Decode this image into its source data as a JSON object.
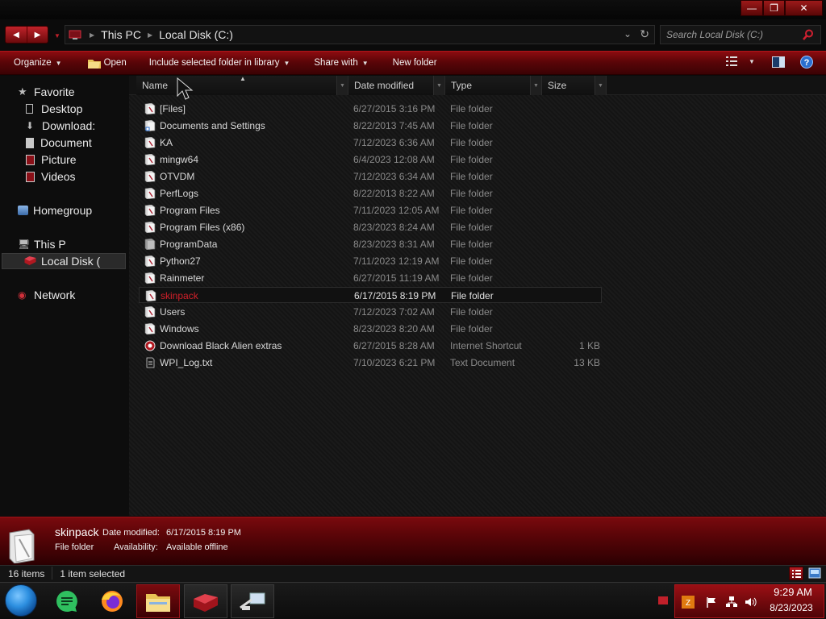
{
  "address": {
    "crumbs": [
      "This PC",
      "Local Disk (C:)"
    ]
  },
  "search": {
    "placeholder": "Search Local Disk (C:)"
  },
  "commandbar": {
    "organize": "Organize",
    "open": "Open",
    "include": "Include selected folder in library",
    "share": "Share with",
    "new_folder": "New folder"
  },
  "nav": {
    "favorites": "Favorite",
    "desktop": "Desktop",
    "downloads": "Download:",
    "documents": "Document",
    "pictures": "Picture",
    "videos": "Videos",
    "homegroup": "Homegroup",
    "thispc": "This P",
    "localdisk": "Local Disk (",
    "network": "Network"
  },
  "columns": {
    "name": "Name",
    "date": "Date modified",
    "type": "Type",
    "size": "Size"
  },
  "files": [
    {
      "name": "[Files]",
      "date": "6/27/2015 3:16 PM",
      "type": "File folder",
      "size": "",
      "icon": "folder-icon"
    },
    {
      "name": "Documents and Settings",
      "date": "8/22/2013 7:45 AM",
      "type": "File folder",
      "size": "",
      "icon": "folder-link-icon"
    },
    {
      "name": "KA",
      "date": "7/12/2023 6:36 AM",
      "type": "File folder",
      "size": "",
      "icon": "folder-icon"
    },
    {
      "name": "mingw64",
      "date": "6/4/2023 12:08 AM",
      "type": "File folder",
      "size": "",
      "icon": "folder-icon"
    },
    {
      "name": "OTVDM",
      "date": "7/12/2023 6:34 AM",
      "type": "File folder",
      "size": "",
      "icon": "folder-icon"
    },
    {
      "name": "PerfLogs",
      "date": "8/22/2013 8:22 AM",
      "type": "File folder",
      "size": "",
      "icon": "folder-icon"
    },
    {
      "name": "Program Files",
      "date": "7/11/2023 12:05 AM",
      "type": "File folder",
      "size": "",
      "icon": "folder-icon"
    },
    {
      "name": "Program Files (x86)",
      "date": "8/23/2023 8:24 AM",
      "type": "File folder",
      "size": "",
      "icon": "folder-icon"
    },
    {
      "name": "ProgramData",
      "date": "8/23/2023 8:31 AM",
      "type": "File folder",
      "size": "",
      "icon": "folder-hidden-icon"
    },
    {
      "name": "Python27",
      "date": "7/11/2023 12:19 AM",
      "type": "File folder",
      "size": "",
      "icon": "folder-icon"
    },
    {
      "name": "Rainmeter",
      "date": "6/27/2015 11:19 AM",
      "type": "File folder",
      "size": "",
      "icon": "folder-icon"
    },
    {
      "name": "skinpack",
      "date": "6/17/2015 8:19 PM",
      "type": "File folder",
      "size": "",
      "icon": "folder-icon"
    },
    {
      "name": "Users",
      "date": "7/12/2023 7:02 AM",
      "type": "File folder",
      "size": "",
      "icon": "folder-icon"
    },
    {
      "name": "Windows",
      "date": "8/23/2023 8:20 AM",
      "type": "File folder",
      "size": "",
      "icon": "folder-icon"
    },
    {
      "name": "Download Black Alien extras",
      "date": "6/27/2015 8:28 AM",
      "type": "Internet Shortcut",
      "size": "1 KB",
      "icon": "internet-shortcut-icon"
    },
    {
      "name": "WPI_Log.txt",
      "date": "7/10/2023 6:21 PM",
      "type": "Text Document",
      "size": "13 KB",
      "icon": "text-file-icon"
    }
  ],
  "selected_index": 11,
  "details": {
    "name": "skinpack",
    "date_label": "Date modified:",
    "date_value": "6/17/2015 8:19 PM",
    "type": "File folder",
    "avail_label": "Availability:",
    "avail_value": "Available offline"
  },
  "status": {
    "count": "16 items",
    "selected": "1 item selected"
  },
  "clock": {
    "time": "9:29 AM",
    "date": "8/23/2023"
  },
  "colors": {
    "accent": "#c0202a",
    "bar_dark": "#3a0204",
    "selected_text": "#d4202a"
  }
}
